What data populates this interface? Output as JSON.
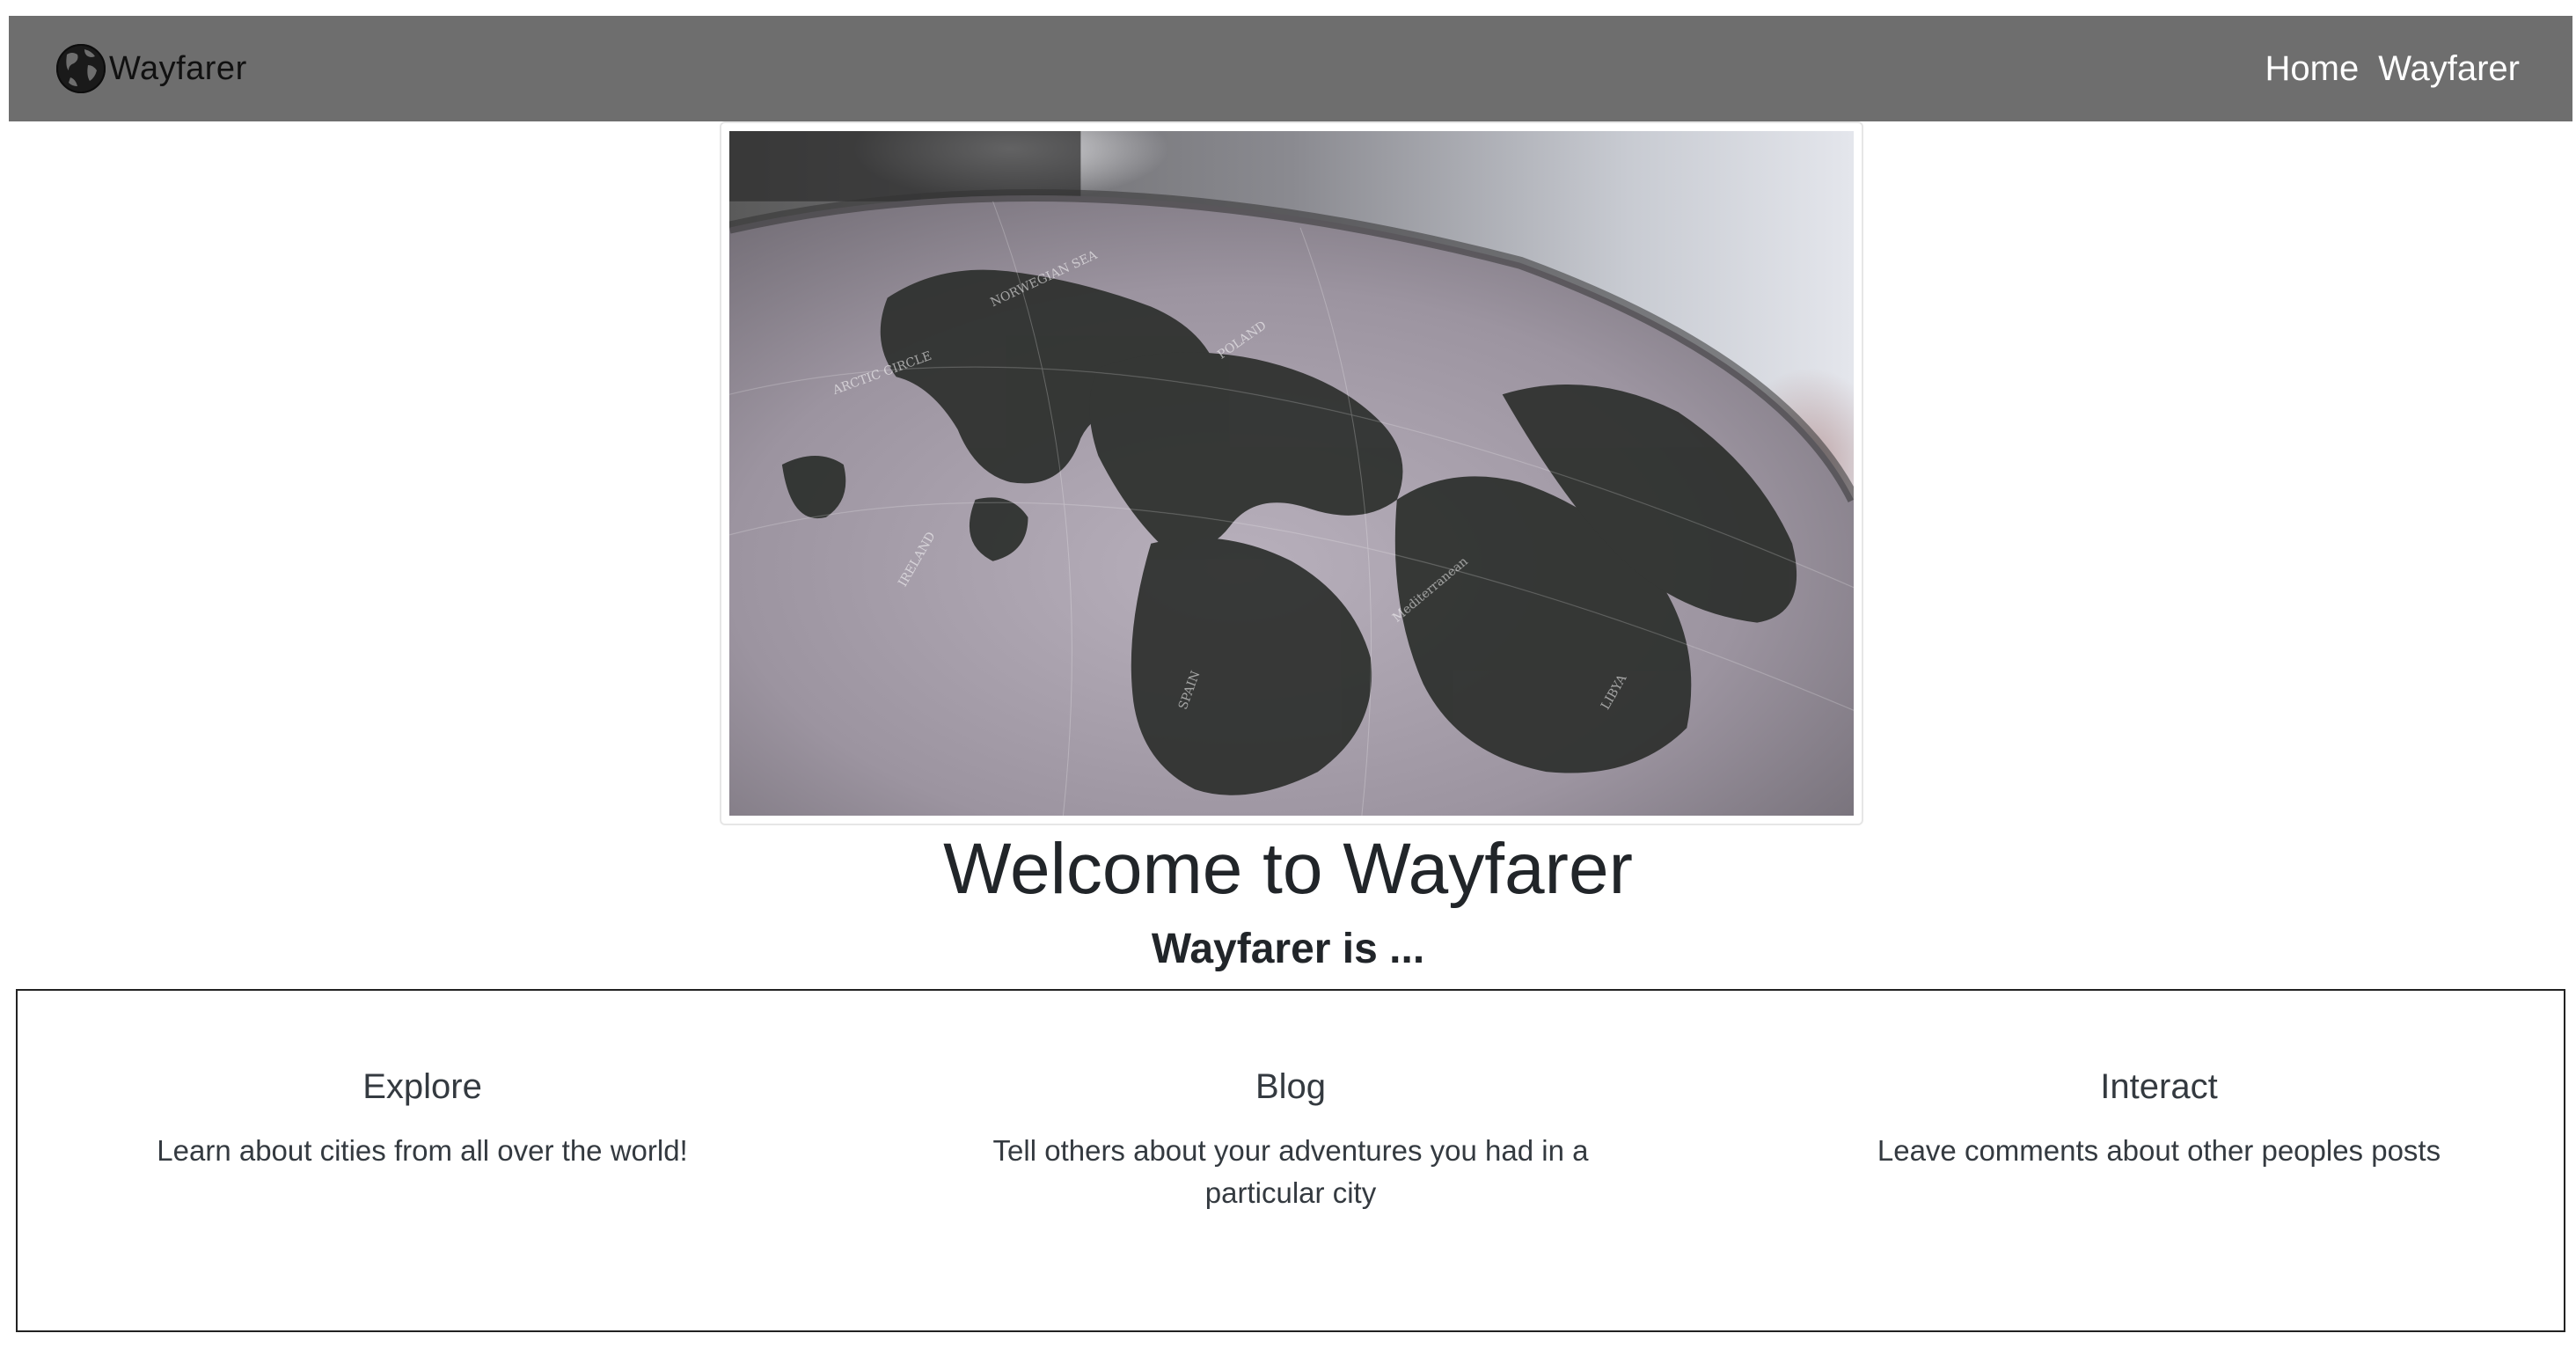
{
  "navbar": {
    "brand": "Wayfarer",
    "logo_icon": "globe-icon",
    "links": [
      {
        "label": "Home"
      },
      {
        "label": "Wayfarer"
      }
    ],
    "background": "#6e6e6e"
  },
  "hero": {
    "image": "globe-map-photo"
  },
  "welcome": {
    "title": "Welcome to Wayfarer",
    "subtitle": "Wayfarer is ..."
  },
  "features": [
    {
      "title": "Explore",
      "text": "Learn about cities from all over the world!"
    },
    {
      "title": "Blog",
      "text": "Tell others about your adventures you had in a particular city"
    },
    {
      "title": "Interact",
      "text": "Leave comments about other peoples posts"
    }
  ]
}
